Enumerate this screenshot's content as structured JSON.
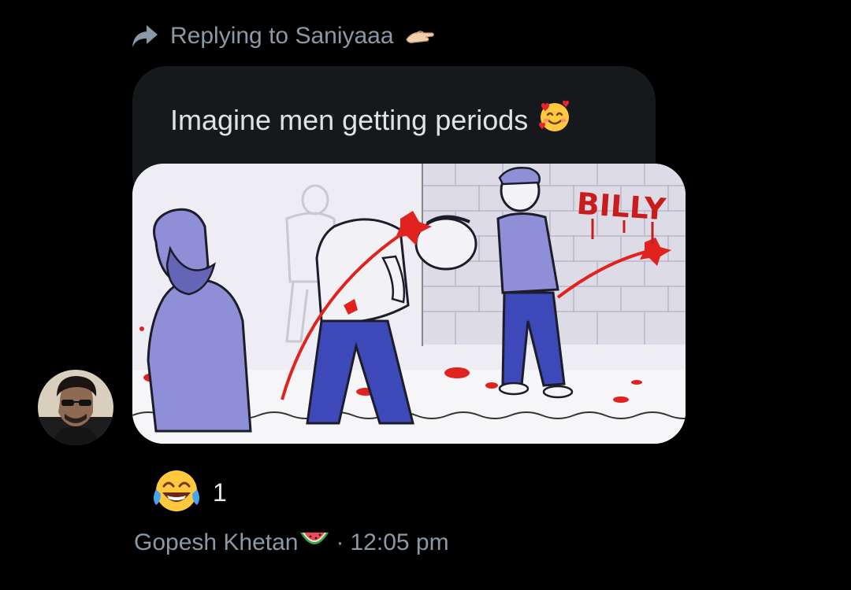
{
  "reply": {
    "prefix": "Replying to",
    "username": "Saniyaaa",
    "icon": "reply-arrow-icon",
    "emoji": "palm-down-hand-emoji"
  },
  "message": {
    "text": "Imagine men getting periods",
    "emoji": "🥰",
    "image": {
      "label": "BILLY",
      "description_icon": "cartoon-image"
    }
  },
  "reactions": [
    {
      "emoji": "😂",
      "count": "1"
    }
  ],
  "footer": {
    "sender": "Gopesh Khetan",
    "sender_emoji": "🍉",
    "separator": "·",
    "time": "12:05 pm"
  },
  "colors": {
    "background": "#000000",
    "bubble": "#16191c",
    "muted_text": "#8b98a5",
    "primary_text": "#e7e9ea",
    "accent_red": "#e0231f"
  }
}
